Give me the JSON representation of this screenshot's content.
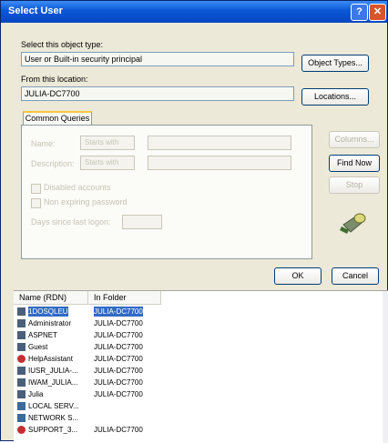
{
  "window": {
    "title": "Select User"
  },
  "object_type": {
    "label": "Select this object type:",
    "value": "User or Built-in security principal",
    "button": "Object Types..."
  },
  "location": {
    "label": "From this location:",
    "value": "JULIA-DC7700",
    "button": "Locations..."
  },
  "tabs": [
    {
      "label": "Common Queries"
    }
  ],
  "queries": {
    "name_label": "Name:",
    "name_op": "Starts with",
    "desc_label": "Description:",
    "desc_op": "Starts with",
    "disabled_label": "Disabled accounts",
    "nonexp_label": "Non expiring password",
    "days_label": "Days since last logon:"
  },
  "side_buttons": {
    "columns": "Columns...",
    "find_now": "Find Now",
    "stop": "Stop"
  },
  "footer": {
    "ok": "OK",
    "cancel": "Cancel"
  },
  "results": {
    "columns": [
      "Name (RDN)",
      "In Folder"
    ],
    "rows": [
      {
        "name": "1DOSQLEU",
        "folder": "JULIA-DC7700"
      },
      {
        "name": "Administrator",
        "folder": "JULIA-DC7700"
      },
      {
        "name": "ASPNET",
        "folder": "JULIA-DC7700"
      },
      {
        "name": "Guest",
        "folder": "JULIA-DC7700"
      },
      {
        "name": "HelpAssistant",
        "folder": "JULIA-DC7700"
      },
      {
        "name": "IUSR_JULIA-...",
        "folder": "JULIA-DC7700"
      },
      {
        "name": "IWAM_JULIA...",
        "folder": "JULIA-DC7700"
      },
      {
        "name": "Julia",
        "folder": "JULIA-DC7700"
      },
      {
        "name": "LOCAL SERV...",
        "folder": ""
      },
      {
        "name": "NETWORK S...",
        "folder": ""
      },
      {
        "name": "SUPPORT_3...",
        "folder": "JULIA-DC7700"
      }
    ]
  }
}
